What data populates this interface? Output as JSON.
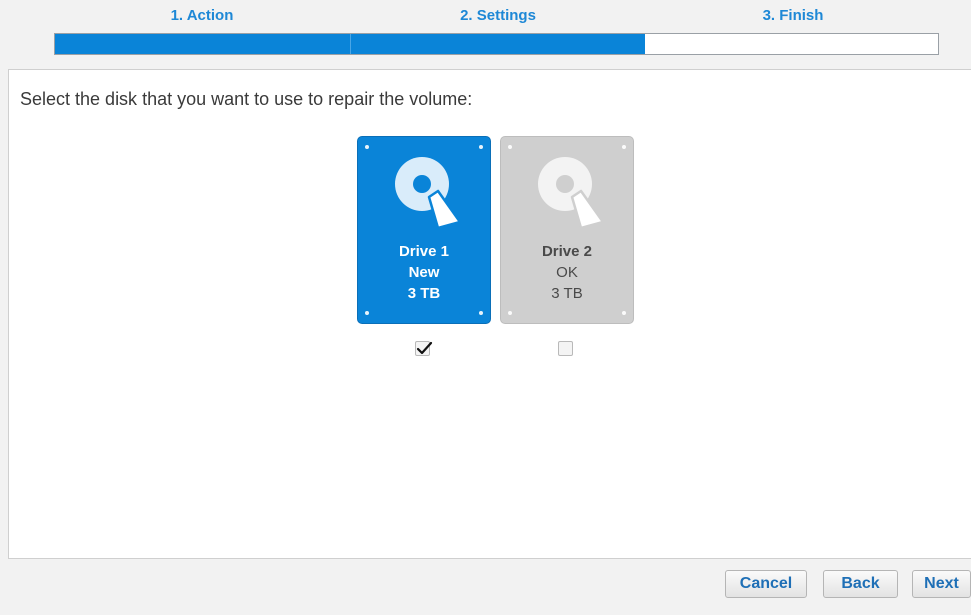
{
  "wizard": {
    "steps": [
      "1. Action",
      "2. Settings",
      "3. Finish"
    ],
    "progress_completed_steps": 2,
    "progress_total_steps": 3
  },
  "main": {
    "prompt": "Select the disk that you want to use to repair the volume:",
    "drives": [
      {
        "name": "Drive 1",
        "status": "New",
        "size": "3 TB",
        "selected": true
      },
      {
        "name": "Drive 2",
        "status": "OK",
        "size": "3 TB",
        "selected": false
      }
    ]
  },
  "buttons": {
    "cancel": "Cancel",
    "back": "Back",
    "next": "Next"
  },
  "colors": {
    "accent": "#0a84d8",
    "label_blue": "#1e88d6",
    "disabled_gray": "#cfcfcf"
  },
  "icons": [
    "hard-drive-icon",
    "checkmark-icon"
  ]
}
